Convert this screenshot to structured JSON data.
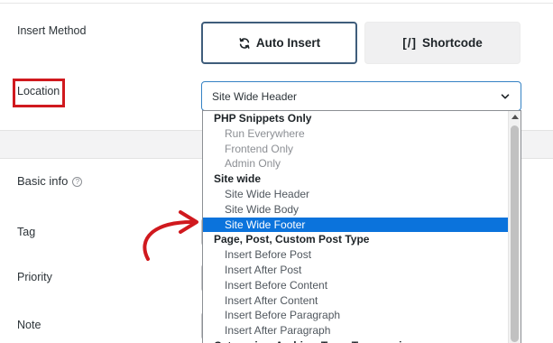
{
  "form": {
    "insert_method_label": "Insert Method",
    "location_label": "Location",
    "basic_info_label": "Basic info",
    "tag_label": "Tag",
    "priority_label": "Priority",
    "note_label": "Note"
  },
  "insert_method": {
    "auto_insert_label": "Auto Insert",
    "shortcode_icon": "[/]",
    "shortcode_label": "Shortcode"
  },
  "location_select": {
    "selected_value": "Site Wide Header"
  },
  "dropdown": {
    "groups": [
      {
        "label": "PHP Snippets Only",
        "options": [
          "Run Everywhere",
          "Frontend Only",
          "Admin Only"
        ]
      },
      {
        "label": "Site wide",
        "options": [
          "Site Wide Header",
          "Site Wide Body",
          "Site Wide Footer"
        ]
      },
      {
        "label": "Page, Post, Custom Post Type",
        "options": [
          "Insert Before Post",
          "Insert After Post",
          "Insert Before Content",
          "Insert After Content",
          "Insert Before Paragraph",
          "Insert After Paragraph"
        ]
      },
      {
        "label": "Categories, Archive, Tags, Taxonomies",
        "options": []
      }
    ],
    "highlighted_option": "Site Wide Footer"
  },
  "colors": {
    "highlight": "#0b73dc",
    "annotation_red": "#d0191e",
    "primary_border": "#3f5d7b"
  }
}
